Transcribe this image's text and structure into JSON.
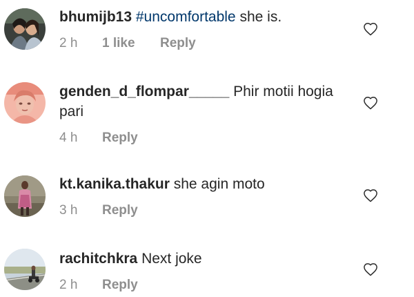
{
  "comments": [
    {
      "username": "bhumijb13",
      "hashtag": "#uncomfortable",
      "text": " she is.",
      "time": "2 h",
      "likes": "1 like",
      "reply": "Reply",
      "avatar_icon": "profile-photo-couple"
    },
    {
      "username": "genden_d_flompar_____",
      "hashtag": "",
      "text": " Phir motii hogia pari",
      "time": "4 h",
      "likes": "",
      "reply": "Reply",
      "avatar_icon": "profile-photo-portrait"
    },
    {
      "username": "kt.kanika.thakur",
      "hashtag": "",
      "text": " she agin moto",
      "time": "3 h",
      "likes": "",
      "reply": "Reply",
      "avatar_icon": "profile-photo-standing-person"
    },
    {
      "username": "rachitchkra",
      "hashtag": "",
      "text": " Next joke",
      "time": "2 h",
      "likes": "",
      "reply": "Reply",
      "avatar_icon": "profile-photo-road"
    }
  ],
  "icons": {
    "like": "heart-outline-icon"
  },
  "colors": {
    "text": "#262626",
    "secondary": "#8e8e8e",
    "hashtag": "#00376b"
  }
}
